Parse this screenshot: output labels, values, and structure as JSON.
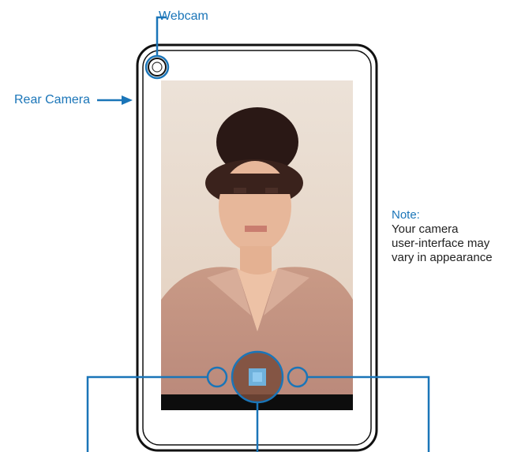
{
  "labels": {
    "webcam": "Webcam",
    "rear_camera": "Rear Camera"
  },
  "note": {
    "title": "Note:",
    "lines": [
      "Your camera",
      "user-interface may",
      "vary in appearance"
    ]
  },
  "colors": {
    "callout": "#1a75b8",
    "device_outline": "#111111",
    "photo_bg": "#e6d2c2",
    "control_bar": "#0d0d0d"
  },
  "icons": {
    "webcam": "camera-lens-icon",
    "shutter": "shutter-button-icon",
    "left_control": "ring-icon",
    "right_control": "ring-icon"
  }
}
